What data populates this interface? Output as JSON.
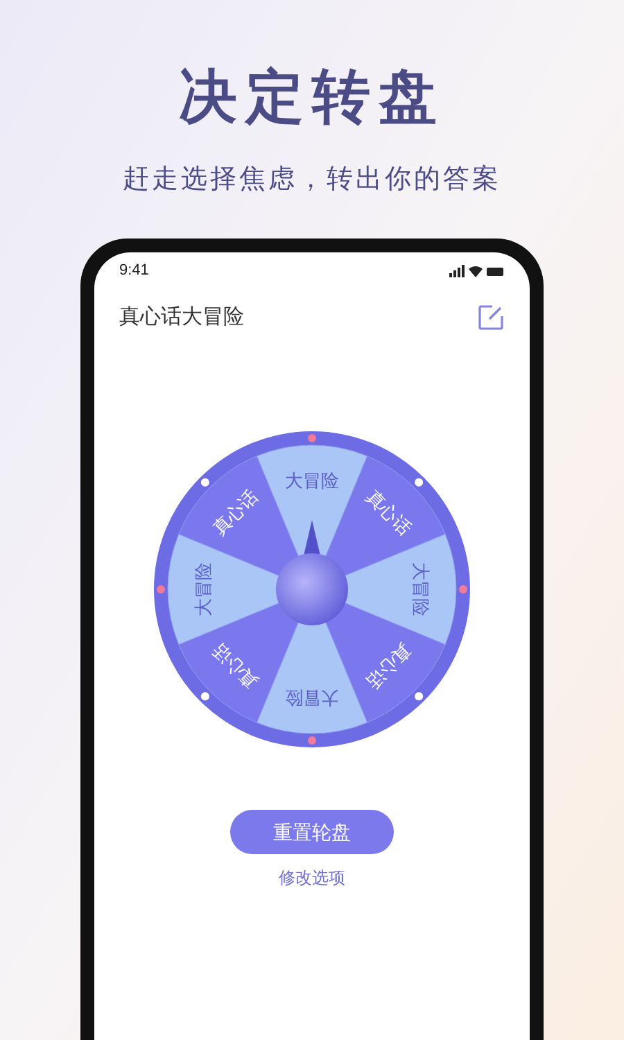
{
  "headline": "决定转盘",
  "tagline": "赶走选择焦虑，转出你的答案",
  "status_bar": {
    "time": "9:41"
  },
  "header": {
    "title": "真心话大冒险"
  },
  "wheel": {
    "sectors": [
      {
        "label": "大冒险",
        "color": "#a9c6f6"
      },
      {
        "label": "真心话",
        "color": "#7a78ec"
      },
      {
        "label": "大冒险",
        "color": "#a9c6f6"
      },
      {
        "label": "真心话",
        "color": "#7a78ec"
      },
      {
        "label": "大冒险",
        "color": "#a9c6f6"
      },
      {
        "label": "真心话",
        "color": "#7a78ec"
      },
      {
        "label": "大冒险",
        "color": "#a9c6f6"
      },
      {
        "label": "真心话",
        "color": "#7a78ec"
      }
    ]
  },
  "reset_button": "重置轮盘",
  "edit_link": "修改选项"
}
